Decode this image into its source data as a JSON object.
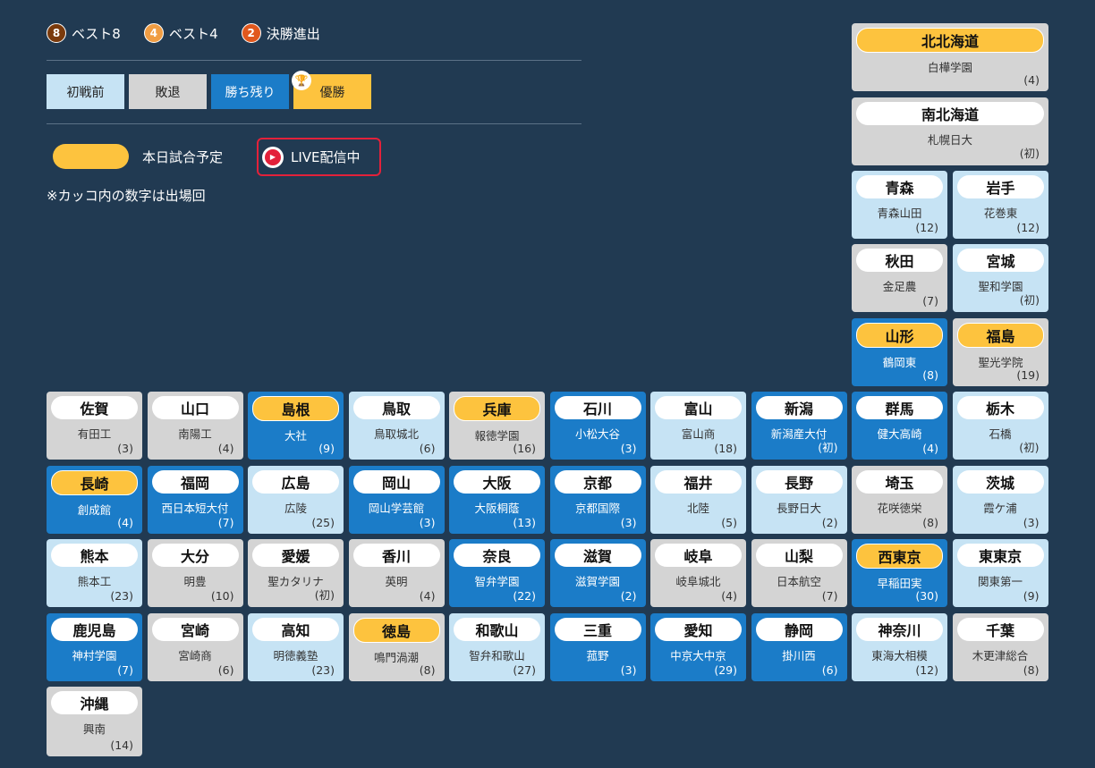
{
  "legend": {
    "ranks": [
      {
        "badge": "8",
        "label": "ベスト8",
        "color": "#7a3a0c"
      },
      {
        "badge": "4",
        "label": "ベスト4",
        "color": "#f09d43"
      },
      {
        "badge": "2",
        "label": "決勝進出",
        "color": "#e1581d"
      }
    ],
    "statuses": [
      {
        "label": "初戦前",
        "class": "st-initial"
      },
      {
        "label": "敗退",
        "class": "st-lost"
      },
      {
        "label": "勝ち残り",
        "class": "st-remain"
      },
      {
        "label": "優勝",
        "class": "st-champion",
        "icon": "trophy-icon"
      }
    ],
    "today_label": "本日試合予定",
    "live_label": "LIVE配信中",
    "note": "※カッコ内の数字は出場回"
  },
  "colors": {
    "background": "#213a52",
    "lost": "#d4d4d4",
    "initial": "#c6e3f4",
    "remain": "#1b7cc8",
    "today": "#fdc33e",
    "live": "#e3213a"
  },
  "prefectures": [
    {
      "pref": "北北海道",
      "school": "白樺学園",
      "count": "(4)",
      "status": "lost",
      "today": true
    },
    {
      "pref": "南北海道",
      "school": "札幌日大",
      "count": "(初)",
      "status": "lost",
      "today": false
    },
    {
      "pref": "青森",
      "school": "青森山田",
      "count": "(12)",
      "status": "initial",
      "today": false
    },
    {
      "pref": "岩手",
      "school": "花巻東",
      "count": "(12)",
      "status": "initial",
      "today": false
    },
    {
      "pref": "秋田",
      "school": "金足農",
      "count": "(7)",
      "status": "lost",
      "today": false
    },
    {
      "pref": "宮城",
      "school": "聖和学園",
      "count": "(初)",
      "status": "initial",
      "today": false
    },
    {
      "pref": "山形",
      "school": "鶴岡東",
      "count": "(8)",
      "status": "remain",
      "today": true
    },
    {
      "pref": "福島",
      "school": "聖光学院",
      "count": "(19)",
      "status": "lost",
      "today": true
    },
    {
      "pref": "佐賀",
      "school": "有田工",
      "count": "(3)",
      "status": "lost",
      "today": false
    },
    {
      "pref": "山口",
      "school": "南陽工",
      "count": "(4)",
      "status": "lost",
      "today": false
    },
    {
      "pref": "島根",
      "school": "大社",
      "count": "(9)",
      "status": "remain",
      "today": true
    },
    {
      "pref": "鳥取",
      "school": "鳥取城北",
      "count": "(6)",
      "status": "initial",
      "today": false
    },
    {
      "pref": "兵庫",
      "school": "報徳学園",
      "count": "(16)",
      "status": "lost",
      "today": true
    },
    {
      "pref": "石川",
      "school": "小松大谷",
      "count": "(3)",
      "status": "remain",
      "today": false
    },
    {
      "pref": "富山",
      "school": "富山商",
      "count": "(18)",
      "status": "initial",
      "today": false
    },
    {
      "pref": "新潟",
      "school": "新潟産大付",
      "count": "(初)",
      "status": "remain",
      "today": false
    },
    {
      "pref": "群馬",
      "school": "健大高崎",
      "count": "(4)",
      "status": "remain",
      "today": false
    },
    {
      "pref": "栃木",
      "school": "石橋",
      "count": "(初)",
      "status": "initial",
      "today": false
    },
    {
      "pref": "長崎",
      "school": "創成館",
      "count": "(4)",
      "status": "remain",
      "today": true
    },
    {
      "pref": "福岡",
      "school": "西日本短大付",
      "count": "(7)",
      "status": "remain",
      "today": false
    },
    {
      "pref": "広島",
      "school": "広陵",
      "count": "(25)",
      "status": "initial",
      "today": false
    },
    {
      "pref": "岡山",
      "school": "岡山学芸館",
      "count": "(3)",
      "status": "remain",
      "today": false
    },
    {
      "pref": "大阪",
      "school": "大阪桐蔭",
      "count": "(13)",
      "status": "remain",
      "today": false
    },
    {
      "pref": "京都",
      "school": "京都国際",
      "count": "(3)",
      "status": "remain",
      "today": false
    },
    {
      "pref": "福井",
      "school": "北陸",
      "count": "(5)",
      "status": "initial",
      "today": false
    },
    {
      "pref": "長野",
      "school": "長野日大",
      "count": "(2)",
      "status": "initial",
      "today": false
    },
    {
      "pref": "埼玉",
      "school": "花咲徳栄",
      "count": "(8)",
      "status": "lost",
      "today": false
    },
    {
      "pref": "茨城",
      "school": "霞ケ浦",
      "count": "(3)",
      "status": "initial",
      "today": false
    },
    {
      "pref": "熊本",
      "school": "熊本工",
      "count": "(23)",
      "status": "initial",
      "today": false
    },
    {
      "pref": "大分",
      "school": "明豊",
      "count": "(10)",
      "status": "lost",
      "today": false
    },
    {
      "pref": "愛媛",
      "school": "聖カタリナ",
      "count": "(初)",
      "status": "lost",
      "today": false
    },
    {
      "pref": "香川",
      "school": "英明",
      "count": "(4)",
      "status": "lost",
      "today": false
    },
    {
      "pref": "奈良",
      "school": "智弁学園",
      "count": "(22)",
      "status": "remain",
      "today": false
    },
    {
      "pref": "滋賀",
      "school": "滋賀学園",
      "count": "(2)",
      "status": "remain",
      "today": false
    },
    {
      "pref": "岐阜",
      "school": "岐阜城北",
      "count": "(4)",
      "status": "lost",
      "today": false
    },
    {
      "pref": "山梨",
      "school": "日本航空",
      "count": "(7)",
      "status": "lost",
      "today": false
    },
    {
      "pref": "西東京",
      "school": "早稲田実",
      "count": "(30)",
      "status": "remain",
      "today": true
    },
    {
      "pref": "東東京",
      "school": "関東第一",
      "count": "(9)",
      "status": "initial",
      "today": false
    },
    {
      "pref": "鹿児島",
      "school": "神村学園",
      "count": "(7)",
      "status": "remain",
      "today": false
    },
    {
      "pref": "宮崎",
      "school": "宮崎商",
      "count": "(6)",
      "status": "lost",
      "today": false
    },
    {
      "pref": "高知",
      "school": "明徳義塾",
      "count": "(23)",
      "status": "initial",
      "today": false
    },
    {
      "pref": "徳島",
      "school": "鳴門渦潮",
      "count": "(8)",
      "status": "lost",
      "today": true
    },
    {
      "pref": "和歌山",
      "school": "智弁和歌山",
      "count": "(27)",
      "status": "initial",
      "today": false
    },
    {
      "pref": "三重",
      "school": "菰野",
      "count": "(3)",
      "status": "remain",
      "today": false
    },
    {
      "pref": "愛知",
      "school": "中京大中京",
      "count": "(29)",
      "status": "remain",
      "today": false
    },
    {
      "pref": "静岡",
      "school": "掛川西",
      "count": "(6)",
      "status": "remain",
      "today": false
    },
    {
      "pref": "神奈川",
      "school": "東海大相模",
      "count": "(12)",
      "status": "initial",
      "today": false
    },
    {
      "pref": "千葉",
      "school": "木更津総合",
      "count": "(8)",
      "status": "lost",
      "today": false
    },
    {
      "pref": "沖縄",
      "school": "興南",
      "count": "(14)",
      "status": "lost",
      "today": false
    }
  ]
}
